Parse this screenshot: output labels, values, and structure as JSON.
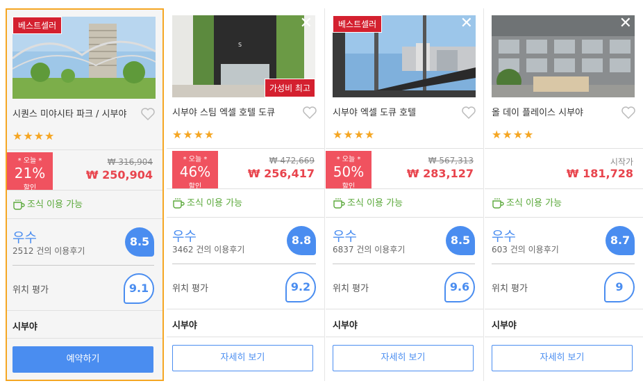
{
  "colors": {
    "accent": "#4a8df0",
    "discount": "#f0525f",
    "price": "#e8444d",
    "best": "#d4202f",
    "breakfast": "#5aa83a",
    "star": "#f5a623",
    "selected_border": "#f5a623"
  },
  "hotels": [
    {
      "best_seller_label": "베스트셀러",
      "value_label": "",
      "name": "시퀀스 미야시타 파크 / 시부야",
      "stars": "★★★★",
      "discount": {
        "today": "* 오늘 *",
        "percent": "21%",
        "label": "할인"
      },
      "original_price": "₩ 316,904",
      "price": "₩ 250,904",
      "from_label": "",
      "breakfast": "조식 이용 가능",
      "grade": "우수",
      "reviews": "2512 건의 이용후기",
      "score": "8.5",
      "location_label": "위치 평가",
      "location_score": "9.1",
      "area": "시부야",
      "button": "예약하기",
      "selected": true,
      "closable": false
    },
    {
      "best_seller_label": "",
      "value_label": "가성비 최고",
      "name": "시부야 스팀 엑셀 호텔 도큐",
      "stars": "★★★★",
      "discount": {
        "today": "* 오늘 *",
        "percent": "46%",
        "label": "할인"
      },
      "original_price": "₩ 472,669",
      "price": "₩ 256,417",
      "from_label": "",
      "breakfast": "조식 이용 가능",
      "grade": "우수",
      "reviews": "3462 건의 이용후기",
      "score": "8.8",
      "location_label": "위치 평가",
      "location_score": "9.2",
      "area": "시부야",
      "button": "자세히 보기",
      "selected": false,
      "closable": true
    },
    {
      "best_seller_label": "베스트셀러",
      "value_label": "",
      "name": "시부야 엑셀 도큐 호텔",
      "stars": "★★★★",
      "discount": {
        "today": "* 오늘 *",
        "percent": "50%",
        "label": "할인"
      },
      "original_price": "₩ 567,313",
      "price": "₩ 283,127",
      "from_label": "",
      "breakfast": "조식 이용 가능",
      "grade": "우수",
      "reviews": "6837 건의 이용후기",
      "score": "8.5",
      "location_label": "위치 평가",
      "location_score": "9.6",
      "area": "시부야",
      "button": "자세히 보기",
      "selected": false,
      "closable": true
    },
    {
      "best_seller_label": "",
      "value_label": "",
      "name": "올 데이 플레이스 시부야",
      "stars": "★★★★",
      "discount": null,
      "original_price": "",
      "price": "₩ 181,728",
      "from_label": "시작가",
      "breakfast": "조식 이용 가능",
      "grade": "우수",
      "reviews": "603 건의 이용후기",
      "score": "8.7",
      "location_label": "위치 평가",
      "location_score": "9",
      "area": "시부야",
      "button": "자세히 보기",
      "selected": false,
      "closable": true
    }
  ]
}
